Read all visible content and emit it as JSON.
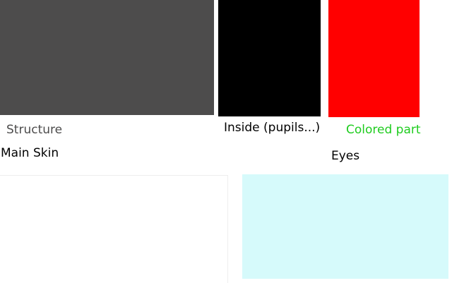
{
  "swatches": [
    {
      "name": "structure",
      "color": "#4d4c4c"
    },
    {
      "name": "inside-pupils",
      "color": "#000000"
    },
    {
      "name": "colored-part",
      "color": "#ff0000"
    },
    {
      "name": "bottom-left",
      "color": "#ffffff"
    },
    {
      "name": "bottom-right",
      "color": "#d6fafb"
    }
  ],
  "labels": {
    "structure": {
      "text": "Structure",
      "color": "#4d4c4c"
    },
    "pupils": {
      "text": "Inside (pupils...)",
      "color": "#000000"
    },
    "colored": {
      "text": "Colored part",
      "color": "#1fcc1f"
    },
    "main_skin": {
      "text": "Main Skin",
      "color": "#000000"
    },
    "eyes": {
      "text": "Eyes",
      "color": "#000000"
    }
  }
}
